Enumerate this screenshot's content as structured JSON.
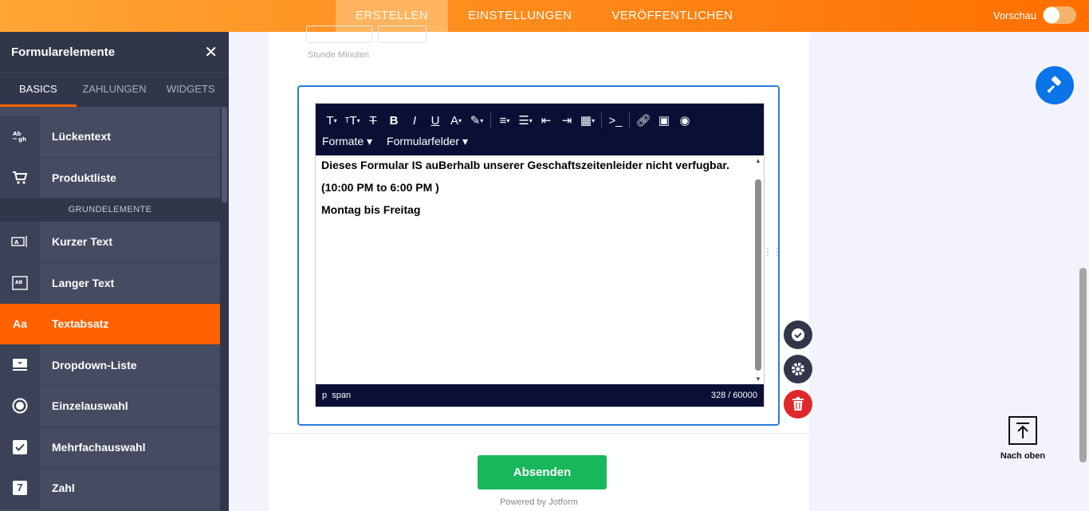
{
  "topbar": {
    "tabs": [
      "ERSTELLEN",
      "EINSTELLUNGEN",
      "VERÖFFENTLICHEN"
    ],
    "preview_label": "Vorschau"
  },
  "sidebar": {
    "title": "Formularelemente",
    "tabs": [
      "BASICS",
      "ZAHLUNGEN",
      "WIDGETS"
    ],
    "items_top": [
      {
        "label": "Lückentext",
        "icon": "fill-in-blank-icon"
      },
      {
        "label": "Produktliste",
        "icon": "cart-icon"
      }
    ],
    "section_label": "GRUNDELEMENTE",
    "items": [
      {
        "label": "Kurzer Text",
        "icon": "short-text-icon"
      },
      {
        "label": "Langer Text",
        "icon": "long-text-icon"
      },
      {
        "label": "Textabsatz",
        "icon": "paragraph-icon",
        "glyph": "Aa"
      },
      {
        "label": "Dropdown-Liste",
        "icon": "dropdown-icon"
      },
      {
        "label": "Einzelauswahl",
        "icon": "radio-icon"
      },
      {
        "label": "Mehrfachauswahl",
        "icon": "checkbox-icon"
      },
      {
        "label": "Zahl",
        "icon": "number-icon",
        "glyph": "7"
      }
    ]
  },
  "form": {
    "time_label": "Stunde Minuten",
    "toolbar": {
      "menus": [
        "Formate",
        "Formularfelder"
      ]
    },
    "content": [
      "Dieses Formular IS auBerhalb unserer Geschaftszeitenleider nicht verfugbar.",
      "(10:00 PM to 6:00 PM )",
      "Montag bis Freitag"
    ],
    "status_path": "p  span",
    "char_count": "328 / 60000",
    "submit_label": "Absenden",
    "powered_by": "Powered by Jotform"
  },
  "right": {
    "to_top_label": "Nach oben"
  },
  "colors": {
    "accent": "#ff6100",
    "editor_bar": "#0a1035",
    "submit": "#18b75b",
    "selection_border": "#2e7cd6",
    "fab": "#0a74e8",
    "delete": "#e0272a"
  }
}
